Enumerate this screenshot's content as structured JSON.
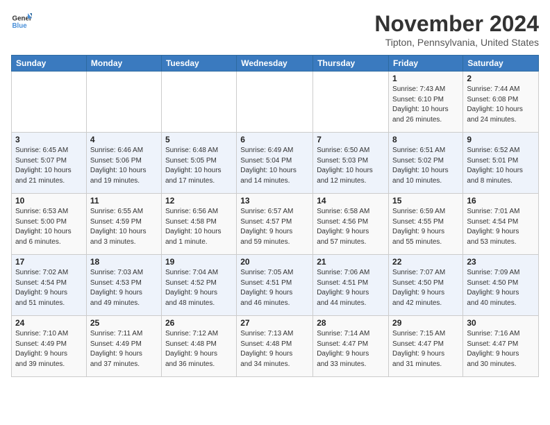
{
  "header": {
    "logo_general": "General",
    "logo_blue": "Blue",
    "month": "November 2024",
    "location": "Tipton, Pennsylvania, United States"
  },
  "weekdays": [
    "Sunday",
    "Monday",
    "Tuesday",
    "Wednesday",
    "Thursday",
    "Friday",
    "Saturday"
  ],
  "weeks": [
    [
      {
        "day": "",
        "detail": ""
      },
      {
        "day": "",
        "detail": ""
      },
      {
        "day": "",
        "detail": ""
      },
      {
        "day": "",
        "detail": ""
      },
      {
        "day": "",
        "detail": ""
      },
      {
        "day": "1",
        "detail": "Sunrise: 7:43 AM\nSunset: 6:10 PM\nDaylight: 10 hours\nand 26 minutes."
      },
      {
        "day": "2",
        "detail": "Sunrise: 7:44 AM\nSunset: 6:08 PM\nDaylight: 10 hours\nand 24 minutes."
      }
    ],
    [
      {
        "day": "3",
        "detail": "Sunrise: 6:45 AM\nSunset: 5:07 PM\nDaylight: 10 hours\nand 21 minutes."
      },
      {
        "day": "4",
        "detail": "Sunrise: 6:46 AM\nSunset: 5:06 PM\nDaylight: 10 hours\nand 19 minutes."
      },
      {
        "day": "5",
        "detail": "Sunrise: 6:48 AM\nSunset: 5:05 PM\nDaylight: 10 hours\nand 17 minutes."
      },
      {
        "day": "6",
        "detail": "Sunrise: 6:49 AM\nSunset: 5:04 PM\nDaylight: 10 hours\nand 14 minutes."
      },
      {
        "day": "7",
        "detail": "Sunrise: 6:50 AM\nSunset: 5:03 PM\nDaylight: 10 hours\nand 12 minutes."
      },
      {
        "day": "8",
        "detail": "Sunrise: 6:51 AM\nSunset: 5:02 PM\nDaylight: 10 hours\nand 10 minutes."
      },
      {
        "day": "9",
        "detail": "Sunrise: 6:52 AM\nSunset: 5:01 PM\nDaylight: 10 hours\nand 8 minutes."
      }
    ],
    [
      {
        "day": "10",
        "detail": "Sunrise: 6:53 AM\nSunset: 5:00 PM\nDaylight: 10 hours\nand 6 minutes."
      },
      {
        "day": "11",
        "detail": "Sunrise: 6:55 AM\nSunset: 4:59 PM\nDaylight: 10 hours\nand 3 minutes."
      },
      {
        "day": "12",
        "detail": "Sunrise: 6:56 AM\nSunset: 4:58 PM\nDaylight: 10 hours\nand 1 minute."
      },
      {
        "day": "13",
        "detail": "Sunrise: 6:57 AM\nSunset: 4:57 PM\nDaylight: 9 hours\nand 59 minutes."
      },
      {
        "day": "14",
        "detail": "Sunrise: 6:58 AM\nSunset: 4:56 PM\nDaylight: 9 hours\nand 57 minutes."
      },
      {
        "day": "15",
        "detail": "Sunrise: 6:59 AM\nSunset: 4:55 PM\nDaylight: 9 hours\nand 55 minutes."
      },
      {
        "day": "16",
        "detail": "Sunrise: 7:01 AM\nSunset: 4:54 PM\nDaylight: 9 hours\nand 53 minutes."
      }
    ],
    [
      {
        "day": "17",
        "detail": "Sunrise: 7:02 AM\nSunset: 4:54 PM\nDaylight: 9 hours\nand 51 minutes."
      },
      {
        "day": "18",
        "detail": "Sunrise: 7:03 AM\nSunset: 4:53 PM\nDaylight: 9 hours\nand 49 minutes."
      },
      {
        "day": "19",
        "detail": "Sunrise: 7:04 AM\nSunset: 4:52 PM\nDaylight: 9 hours\nand 48 minutes."
      },
      {
        "day": "20",
        "detail": "Sunrise: 7:05 AM\nSunset: 4:51 PM\nDaylight: 9 hours\nand 46 minutes."
      },
      {
        "day": "21",
        "detail": "Sunrise: 7:06 AM\nSunset: 4:51 PM\nDaylight: 9 hours\nand 44 minutes."
      },
      {
        "day": "22",
        "detail": "Sunrise: 7:07 AM\nSunset: 4:50 PM\nDaylight: 9 hours\nand 42 minutes."
      },
      {
        "day": "23",
        "detail": "Sunrise: 7:09 AM\nSunset: 4:50 PM\nDaylight: 9 hours\nand 40 minutes."
      }
    ],
    [
      {
        "day": "24",
        "detail": "Sunrise: 7:10 AM\nSunset: 4:49 PM\nDaylight: 9 hours\nand 39 minutes."
      },
      {
        "day": "25",
        "detail": "Sunrise: 7:11 AM\nSunset: 4:49 PM\nDaylight: 9 hours\nand 37 minutes."
      },
      {
        "day": "26",
        "detail": "Sunrise: 7:12 AM\nSunset: 4:48 PM\nDaylight: 9 hours\nand 36 minutes."
      },
      {
        "day": "27",
        "detail": "Sunrise: 7:13 AM\nSunset: 4:48 PM\nDaylight: 9 hours\nand 34 minutes."
      },
      {
        "day": "28",
        "detail": "Sunrise: 7:14 AM\nSunset: 4:47 PM\nDaylight: 9 hours\nand 33 minutes."
      },
      {
        "day": "29",
        "detail": "Sunrise: 7:15 AM\nSunset: 4:47 PM\nDaylight: 9 hours\nand 31 minutes."
      },
      {
        "day": "30",
        "detail": "Sunrise: 7:16 AM\nSunset: 4:47 PM\nDaylight: 9 hours\nand 30 minutes."
      }
    ]
  ]
}
